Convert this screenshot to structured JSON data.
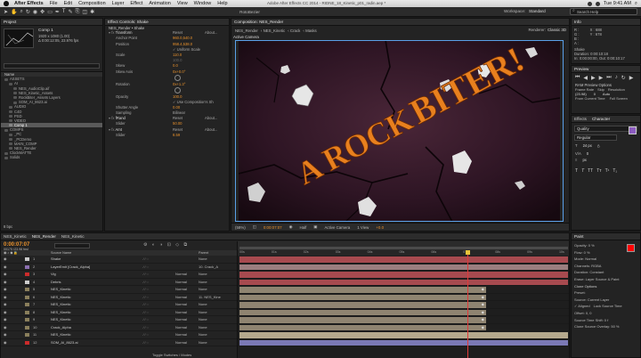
{
  "menubar": {
    "app": "After Effects",
    "items": [
      "File",
      "Edit",
      "Composition",
      "Layer",
      "Effect",
      "Animation",
      "View",
      "Window",
      "Help"
    ],
    "window_title": "Adobe After Effects CC 2014 - RIDNE_18_Kinetic_p01_radin.aep *",
    "clock": "Tue 9:41 AM"
  },
  "toolbar": {
    "label": "RotoBezier",
    "workspace_label": "Workspace:",
    "workspace_value": "Standard",
    "search_placeholder": "Search Help"
  },
  "project": {
    "tab": "Project",
    "comp_name": "Comp 1",
    "comp_info": "1920 x 1080 (1.00)",
    "comp_duration": "Δ 0:00:12:05, 23.976 fps",
    "header_name": "Name",
    "items": [
      {
        "label": "ASSETS",
        "indent": 0,
        "color": "#555555"
      },
      {
        "label": "AI",
        "indent": 1,
        "color": "#555555"
      },
      {
        "label": "NES_AudioClip.aif",
        "indent": 2,
        "color": "#555555"
      },
      {
        "label": "NES_Kinetic_Assets",
        "indent": 2,
        "color": "#555555"
      },
      {
        "label": "RockBiter_Assets Layers",
        "indent": 2,
        "color": "#555555"
      },
      {
        "label": "SOM_AI_8623.ai",
        "indent": 2,
        "color": "#555555"
      },
      {
        "label": "AUDIO",
        "indent": 1,
        "color": "#555555"
      },
      {
        "label": "C4D",
        "indent": 1,
        "color": "#555555"
      },
      {
        "label": "PSD",
        "indent": 1,
        "color": "#555555"
      },
      {
        "label": "VIDEO",
        "indent": 1,
        "color": "#555555"
      },
      {
        "label": "Comp 1",
        "indent": 1,
        "color": "#888888",
        "selected": true
      },
      {
        "label": "COMPS",
        "indent": 0,
        "color": "#555555"
      },
      {
        "label": "_PC",
        "indent": 1,
        "color": "#555555"
      },
      {
        "label": "_PCDemo",
        "indent": 1,
        "color": "#555555"
      },
      {
        "label": "MAIN_COMP",
        "indent": 1,
        "color": "#555555"
      },
      {
        "label": "NES_Render",
        "indent": 1,
        "color": "#555555"
      },
      {
        "label": "ClockMATTE",
        "indent": 0,
        "color": "#555555"
      },
      {
        "label": "Solids",
        "indent": 0,
        "color": "#555555"
      }
    ],
    "bpc": "8 bpc"
  },
  "effect_controls": {
    "tab": "Effect Controls: Shake",
    "layer": "NES_Render • Shake",
    "rows": [
      {
        "label": "Transform",
        "value": "Reset",
        "extra": "About...",
        "indent": 0,
        "kind": "group"
      },
      {
        "label": "Anchor Point",
        "value": "960.0,540.0",
        "indent": 1
      },
      {
        "label": "Position",
        "value": "958.4,538.0",
        "indent": 1
      },
      {
        "label": "",
        "value": "✓ Uniform Scale",
        "indent": 1,
        "kind": "check"
      },
      {
        "label": "Scale",
        "value": "110.0",
        "indent": 1
      },
      {
        "label": "",
        "value": "100.0",
        "indent": 1,
        "kind": "dim"
      },
      {
        "label": "Skew",
        "value": "0.0",
        "indent": 1
      },
      {
        "label": "Skew Axis",
        "value": "0x+0.0°",
        "indent": 1,
        "kind": "dial"
      },
      {
        "label": "Rotation",
        "value": "0x+1.3°",
        "indent": 1,
        "kind": "dial"
      },
      {
        "label": "Opacity",
        "value": "100.0",
        "indent": 1
      },
      {
        "label": "",
        "value": "✓ Use Composition's Sh",
        "indent": 1,
        "kind": "check"
      },
      {
        "label": "Shutter Angle",
        "value": "0.00",
        "indent": 1
      },
      {
        "label": "Sampling",
        "value": "Bilinear",
        "indent": 1,
        "kind": "select"
      },
      {
        "label": "fRand",
        "value": "Reset",
        "extra": "About...",
        "indent": 0,
        "kind": "group"
      },
      {
        "label": "Slider",
        "value": "50.00",
        "indent": 1
      },
      {
        "label": "Amt",
        "value": "Reset",
        "extra": "About...",
        "indent": 0,
        "kind": "group"
      },
      {
        "label": "Slider",
        "value": "8.59",
        "indent": 1
      }
    ]
  },
  "composition": {
    "tab": "Composition: NES_Render",
    "breadcrumb": [
      "NES_Render",
      "NES_Kinetic",
      "Crack",
      "Masks"
    ],
    "renderer_label": "Renderer:",
    "renderer_value": "Classic 3D",
    "camera_label": "Active Camera",
    "title_line1": "A ROCK",
    "title_line2": "BITER!",
    "footer": {
      "zoom": "(58%)",
      "time": "0:00:07:07",
      "resolution": "Half",
      "camera": "Active Camera",
      "view": "1 View",
      "exposure": "+0.0"
    }
  },
  "info_panel": {
    "tab": "Info",
    "r": "R :",
    "g": "G :",
    "b": "B :",
    "a": "A :",
    "x": "X : 688",
    "y": "Y : 678",
    "layer": "Shake",
    "duration": "Duration: 0:00:10:18",
    "in_out": "In: 0:00:00:00, Out: 0:00:10:17"
  },
  "preview_panel": {
    "tab": "Preview",
    "ram_options": "RAM Preview Options",
    "frame_rate_label": "Frame Rate",
    "skip_label": "Skip",
    "resolution_label": "Resolution",
    "frame_rate": "(23.98)",
    "skip": "0",
    "resolution": "Auto",
    "from_current": "From Current Time",
    "full_screen": "Full Screen"
  },
  "character_panel": {
    "tabs": [
      "Effects",
      "Character"
    ],
    "font": "Quality",
    "style": "Regular",
    "size": "24 px",
    "tracking": "0",
    "units": "px"
  },
  "paint_panel": {
    "tab": "Paint",
    "opacity": "Opacity: 0 %",
    "flow": "Flow: 0 %",
    "mode": "Mode: Normal",
    "channels": "Channels: RGBA",
    "duration": "Duration: Constant",
    "erase": "Erase: Layer Source & Paint",
    "clone_options": "Clone Options",
    "preset": "Preset:",
    "source": "Source: Current Layer",
    "aligned": "✓ Aligned",
    "lock_source": "Lock Source Time",
    "offset": "Offset: 0, 0",
    "source_time_shift": "Source Time Shift: 0 f",
    "clone_overlay": "Clone Source Overlay: 50 %",
    "fg_color": "#ff0000",
    "bg_color": "#ffffff"
  },
  "timeline": {
    "tabs": [
      "NES_Kinetic",
      "NES_Render",
      "NES_Kinetic"
    ],
    "timecode": "0:00:07:07",
    "fps_info": "00175 (23.98 fps)",
    "col_source": "Source Name",
    "col_parent": "Parent",
    "ruler": [
      "00s",
      "01s",
      "02s",
      "03s",
      "04s",
      "05s",
      "06s",
      "07s",
      "08s",
      "09s",
      "10s"
    ],
    "footer": "Toggle Switches / Modes",
    "layers": [
      {
        "num": "1",
        "name": "Shake",
        "color": "#c9c9c9",
        "parent": "None",
        "mode": "",
        "bar": "#a74a4f",
        "start": 0.0,
        "end": 1.0
      },
      {
        "num": "2",
        "name": "LayerEmit [Crack_Alpha]",
        "color": "#8b6fb0",
        "parent": "10. Crack_A",
        "mode": "",
        "bar": "#9b7e7f",
        "start": 0.0,
        "end": 1.0
      },
      {
        "num": "3",
        "name": "Vig",
        "color": "#cc2b2b",
        "parent": "None",
        "mode": "Normal",
        "bar": "#a74a4f",
        "start": 0.0,
        "end": 1.0
      },
      {
        "num": "4",
        "name": "Debris",
        "color": "#cccccc",
        "parent": "None",
        "mode": "Normal",
        "bar": "#a74a4f",
        "start": 0.0,
        "end": 1.0
      },
      {
        "num": "5",
        "name": "NES_Kinetic",
        "color": "#8a7f5c",
        "parent": "None",
        "mode": "Normal",
        "bar": "#8f8471",
        "start": 0.0,
        "end": 0.75
      },
      {
        "num": "6",
        "name": "NES_Kinetic",
        "color": "#8a7f5c",
        "parent": "11. NES_Kine",
        "mode": "Normal",
        "bar": "#8f8471",
        "start": 0.0,
        "end": 0.75
      },
      {
        "num": "7",
        "name": "NES_Kinetic",
        "color": "#8a7f5c",
        "parent": "None",
        "mode": "Normal",
        "bar": "#8f8471",
        "start": 0.0,
        "end": 0.75
      },
      {
        "num": "8",
        "name": "NES_Kinetic",
        "color": "#8a7f5c",
        "parent": "None",
        "mode": "Normal",
        "bar": "#8f8471",
        "start": 0.0,
        "end": 0.75
      },
      {
        "num": "9",
        "name": "NES_Kinetic",
        "color": "#8a7f5c",
        "parent": "None",
        "mode": "Normal",
        "bar": "#8f8471",
        "start": 0.0,
        "end": 0.75
      },
      {
        "num": "10",
        "name": "Crack_Alpha",
        "color": "#8a7f5c",
        "parent": "None",
        "mode": "Normal",
        "bar": "#8f8471",
        "start": 0.0,
        "end": 0.75
      },
      {
        "num": "11",
        "name": "NES_Kinetic",
        "color": "#8a7f5c",
        "parent": "None",
        "mode": "Normal",
        "bar": "#b5a98d",
        "start": 0.0,
        "end": 1.0
      },
      {
        "num": "12",
        "name": "SOM_AI_8623.ai",
        "color": "#cc2b2b",
        "parent": "None",
        "mode": "Normal",
        "bar": "#7b79b5",
        "start": 0.0,
        "end": 1.0
      }
    ],
    "playhead": 0.695
  }
}
